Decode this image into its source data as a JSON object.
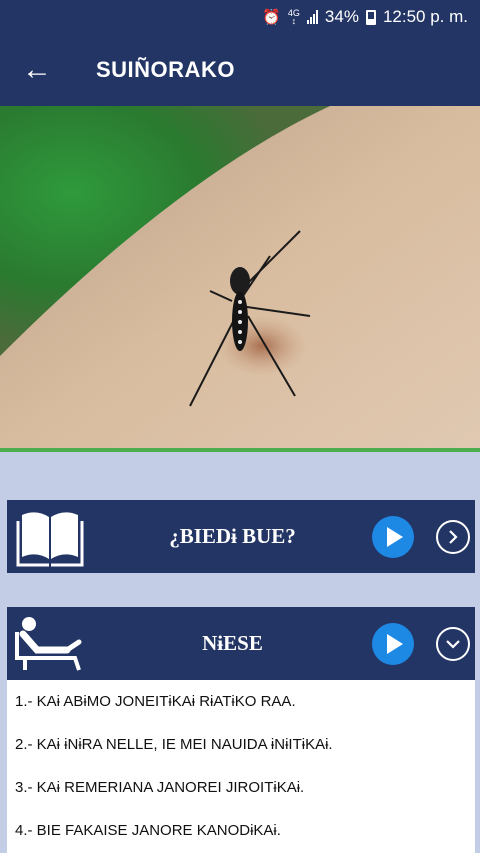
{
  "status_bar": {
    "network": "4G",
    "battery": "34%",
    "time": "12:50 p. m."
  },
  "app_bar": {
    "title": "SUIÑORAKO"
  },
  "sections": [
    {
      "title": "¿BIEDɨ BUE?",
      "icon": "open-book-icon",
      "state": "collapsed"
    },
    {
      "title": "NɨESE",
      "icon": "person-resting-icon",
      "state": "expanded"
    }
  ],
  "list_items": [
    "1.- KAɨ ABɨMO JONEITɨKAɨ RɨATɨKO RAA.",
    "2.- KAɨ ɨNɨRA NELLE, IE MEI NAUIDA ɨNɨITɨKAɨ.",
    "3.- KAɨ REMERIANA JANOREI JIROITɨKAɨ.",
    "4.- BIE FAKAISE JANORE KANODɨKAɨ."
  ],
  "colors": {
    "primary": "#233565",
    "background": "#c4cde6",
    "play_button": "#1e88e5",
    "accent_line": "#4cae4f"
  }
}
